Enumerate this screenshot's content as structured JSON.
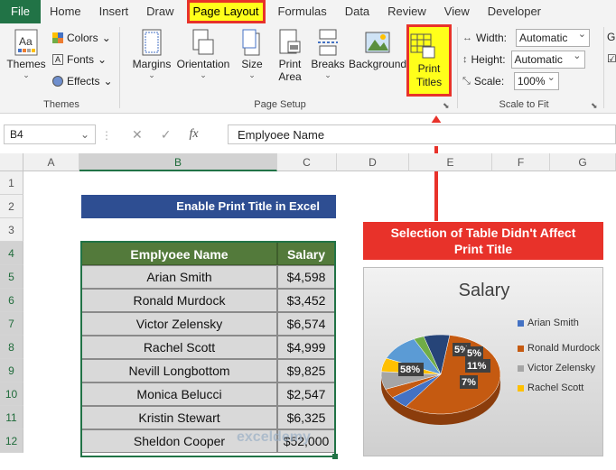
{
  "tabs": [
    "File",
    "Home",
    "Insert",
    "Draw",
    "Page Layout",
    "Formulas",
    "Data",
    "Review",
    "View",
    "Developer"
  ],
  "ribbon": {
    "themes": {
      "btn": "Themes",
      "colors": "Colors",
      "fonts": "Fonts",
      "effects": "Effects",
      "group": "Themes"
    },
    "page_setup": {
      "margins": "Margins",
      "orientation": "Orientation",
      "size": "Size",
      "print_area_1": "Print",
      "print_area_2": "Area",
      "breaks": "Breaks",
      "background": "Background",
      "print_titles_1": "Print",
      "print_titles_2": "Titles",
      "group": "Page Setup"
    },
    "scale": {
      "width_label": "Width:",
      "width_value": "Automatic",
      "height_label": "Height:",
      "height_value": "Automatic",
      "scale_label": "Scale:",
      "scale_value": "100%",
      "group": "Scale to Fit"
    }
  },
  "formula_bar": {
    "name_box": "B4",
    "fx": "fx",
    "content": "Emplyoee Name"
  },
  "columns": [
    "A",
    "B",
    "C",
    "D",
    "E",
    "F",
    "G"
  ],
  "rows": [
    "1",
    "2",
    "3",
    "4",
    "5",
    "6",
    "7",
    "8",
    "9",
    "10",
    "11",
    "12"
  ],
  "sheet": {
    "title": "Enable Print Title in Excel",
    "headers": [
      "Emplyoee Name",
      "Salary"
    ],
    "data": [
      [
        "Arian Smith",
        "$4,598"
      ],
      [
        "Ronald Murdock",
        "$3,452"
      ],
      [
        "Victor Zelensky",
        "$6,574"
      ],
      [
        "Rachel Scott",
        "$4,999"
      ],
      [
        "Nevill Longbottom",
        "$9,825"
      ],
      [
        "Monica Belucci",
        "$2,547"
      ],
      [
        "Kristin Stewart",
        "$6,325"
      ],
      [
        "Sheldon Cooper",
        "$52,000"
      ]
    ]
  },
  "callout": {
    "line1": "Selection of Table Didn't Affect",
    "line2": "Print Title"
  },
  "chart": {
    "title": "Salary",
    "slice_labels": [
      "58%",
      "7%",
      "5%",
      "5%",
      "11%"
    ],
    "legend": [
      "Arian Smith",
      "Ronald Murdock",
      "Victor Zelensky",
      "Rachel Scott"
    ],
    "colors": [
      "#4472c4",
      "#c55a11",
      "#a5a5a5",
      "#ffc000"
    ]
  },
  "watermark": "exceldemy",
  "chart_data": {
    "type": "pie",
    "title": "Salary",
    "categories": [
      "Arian Smith",
      "Ronald Murdock",
      "Victor Zelensky",
      "Rachel Scott",
      "Nevill Longbottom",
      "Monica Belucci",
      "Kristin Stewart",
      "Sheldon Cooper"
    ],
    "values": [
      4598,
      3452,
      6574,
      4999,
      9825,
      2547,
      6325,
      52000
    ],
    "legend": "right"
  }
}
